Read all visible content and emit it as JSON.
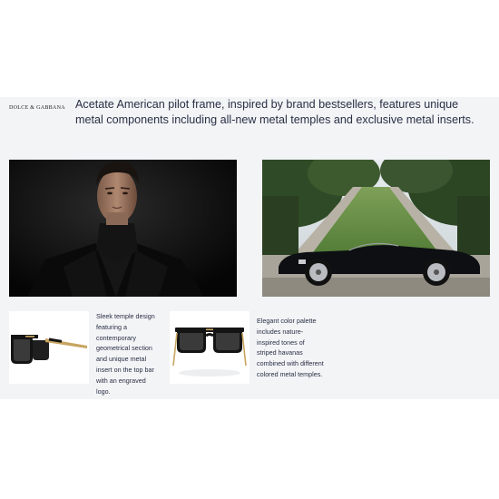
{
  "brand": {
    "logo_text": "DOLCE & GABBANA"
  },
  "headline": "Acetate American pilot frame, inspired by brand bestsellers, features unique metal components including all-new metal temples and exclusive metal inserts.",
  "images": {
    "model_alt": "Model in black turtleneck and jacket",
    "car_alt": "Black vintage convertible car in a garden"
  },
  "features": [
    {
      "caption": "Sleek temple design featuring a contemporary geometrical section and unique metal insert on the top bar with an engraved logo."
    },
    {
      "caption": "Elegant color palette includes nature-inspired tones of striped havanas combined with different colored metal temples."
    }
  ],
  "colors": {
    "panel_bg": "#f2f4f6",
    "text": "#2a2f45",
    "frame_black": "#141414",
    "temple_gold": "#c8a560"
  }
}
